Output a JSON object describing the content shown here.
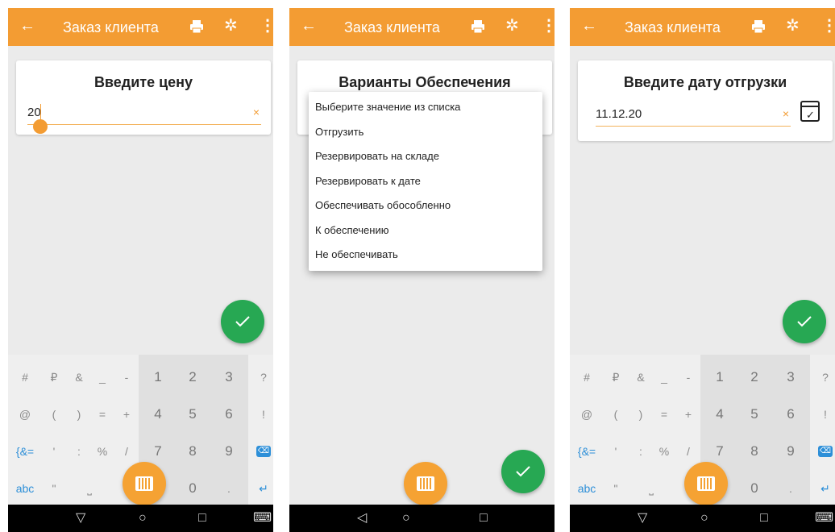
{
  "appbar": {
    "back": "←",
    "title": "Заказ клиента",
    "gear": "✲",
    "more": "⋮"
  },
  "screen1": {
    "heading": "Введите цену",
    "value": "20",
    "clear": "×"
  },
  "screen2": {
    "heading": "Варианты Обеспечения",
    "options": [
      "Выберите значение из списка",
      "Отгрузить",
      "Резервировать на складе",
      "Резервировать к дате",
      "Обеспечивать обособленно",
      "К обеспечению",
      "Не обеспечивать"
    ]
  },
  "screen3": {
    "heading": "Введите дату отгрузки",
    "value": "11.12.20",
    "clear": "×",
    "calendar_check": "✓"
  },
  "keyboard": {
    "row1": [
      "#",
      "₽",
      "&",
      "_",
      "-",
      "1",
      "2",
      "3",
      "?"
    ],
    "row2": [
      "@",
      "(",
      ")",
      "=",
      "+",
      "4",
      "5",
      "6",
      "!"
    ],
    "row3": [
      "{&=",
      "'",
      ":",
      "%",
      "/",
      "7",
      "8",
      "9",
      "⌫"
    ],
    "row4": [
      "abc",
      "\"",
      "⎵",
      "",
      "0",
      ".",
      "↵"
    ]
  },
  "navbar": {
    "back": "▽",
    "back_left": "◁",
    "home": "○",
    "recents": "□",
    "keyboard": "⌨"
  },
  "colors": {
    "accent": "#f39c33",
    "fab_green": "#27a853",
    "key_blue": "#2d8fd8"
  }
}
